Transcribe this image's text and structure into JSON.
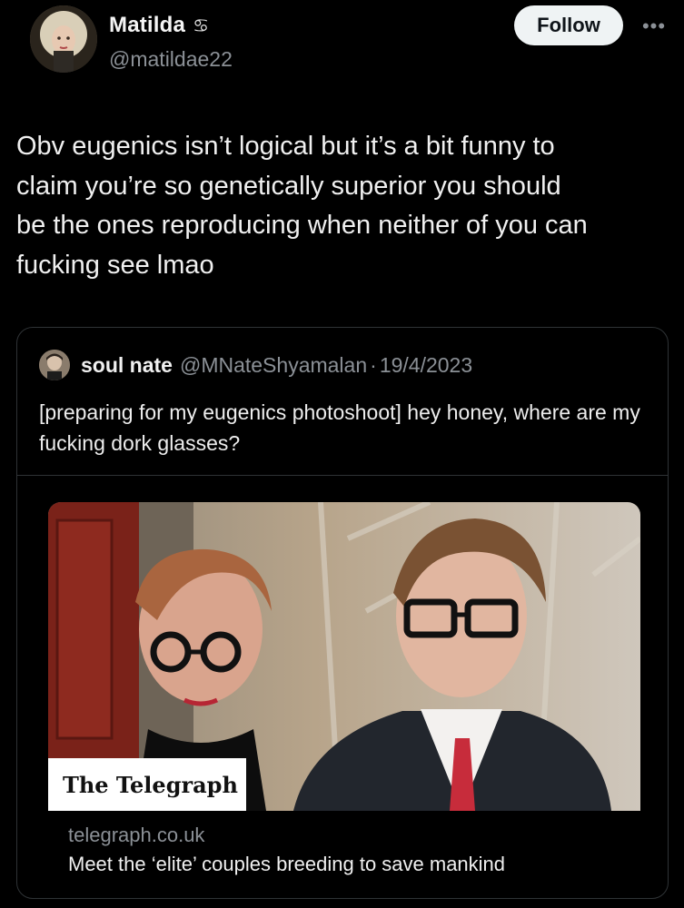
{
  "author": {
    "display_name": "Matilda",
    "name_emoji": "♋",
    "handle": "@matildae22"
  },
  "actions": {
    "follow_label": "Follow",
    "more_label": "•••"
  },
  "tweet": {
    "text": "Obv eugenics isn’t logical but it’s a bit funny to\nclaim you’re so genetically superior you should\nbe the ones reproducing when neither of you can\nfucking see lmao"
  },
  "quote": {
    "name": "soul nate",
    "handle": "@MNateShyamalan",
    "separator": "·",
    "date": "19/4/2023",
    "text": "[preparing for my eugenics photoshoot] hey honey, where are my fucking dork glasses?"
  },
  "link_card": {
    "publisher": "The Telegraph",
    "domain": "telegraph.co.uk",
    "title": "Meet the ‘elite’ couples breeding to save mankind"
  },
  "icons": {
    "more": "more-horizontal-icon"
  }
}
